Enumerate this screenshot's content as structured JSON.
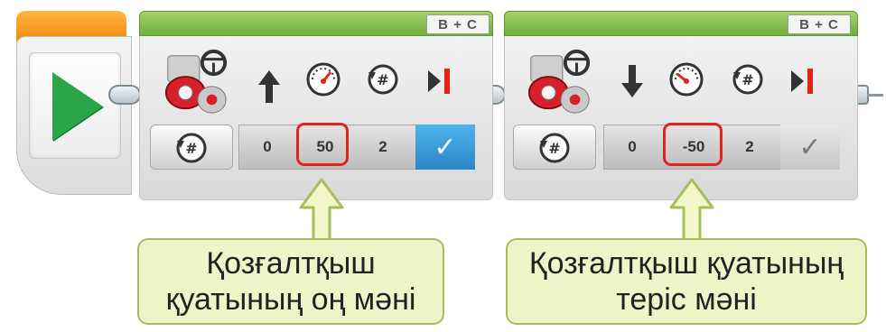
{
  "program": {
    "start_block": {
      "icon": "play-icon"
    },
    "blocks": [
      {
        "ports": "B + C",
        "mode_icon": "rotations-icon",
        "header_icons": [
          "tank-motor-icon",
          "arrow-up-icon",
          "speedometer-icon",
          "rotations-icon",
          "brake-at-end-icon"
        ],
        "values": [
          "0",
          "50",
          "2"
        ],
        "brake_checked": true,
        "highlighted_value": "50"
      },
      {
        "ports": "B + C",
        "mode_icon": "rotations-icon",
        "header_icons": [
          "tank-motor-icon",
          "arrow-down-icon",
          "speedometer-icon",
          "rotations-icon",
          "brake-at-end-icon"
        ],
        "values": [
          "0",
          "-50",
          "2"
        ],
        "brake_checked": false,
        "highlighted_value": "-50"
      }
    ]
  },
  "callouts": {
    "left": {
      "line1": "Қозғалтқыш",
      "line2": "қуатының оң мәні"
    },
    "right": {
      "line1": "Қозғалтқыш қуатының",
      "line2": "теріс мәні"
    }
  },
  "colors": {
    "start_accent": "#f08a12",
    "play": "#2aa54a",
    "header_green": "#6fae3d",
    "highlight_red": "#e2231a",
    "check_blue": "#2a86c8",
    "callout_bg": "#eef5c9",
    "callout_border": "#a3c05a"
  }
}
